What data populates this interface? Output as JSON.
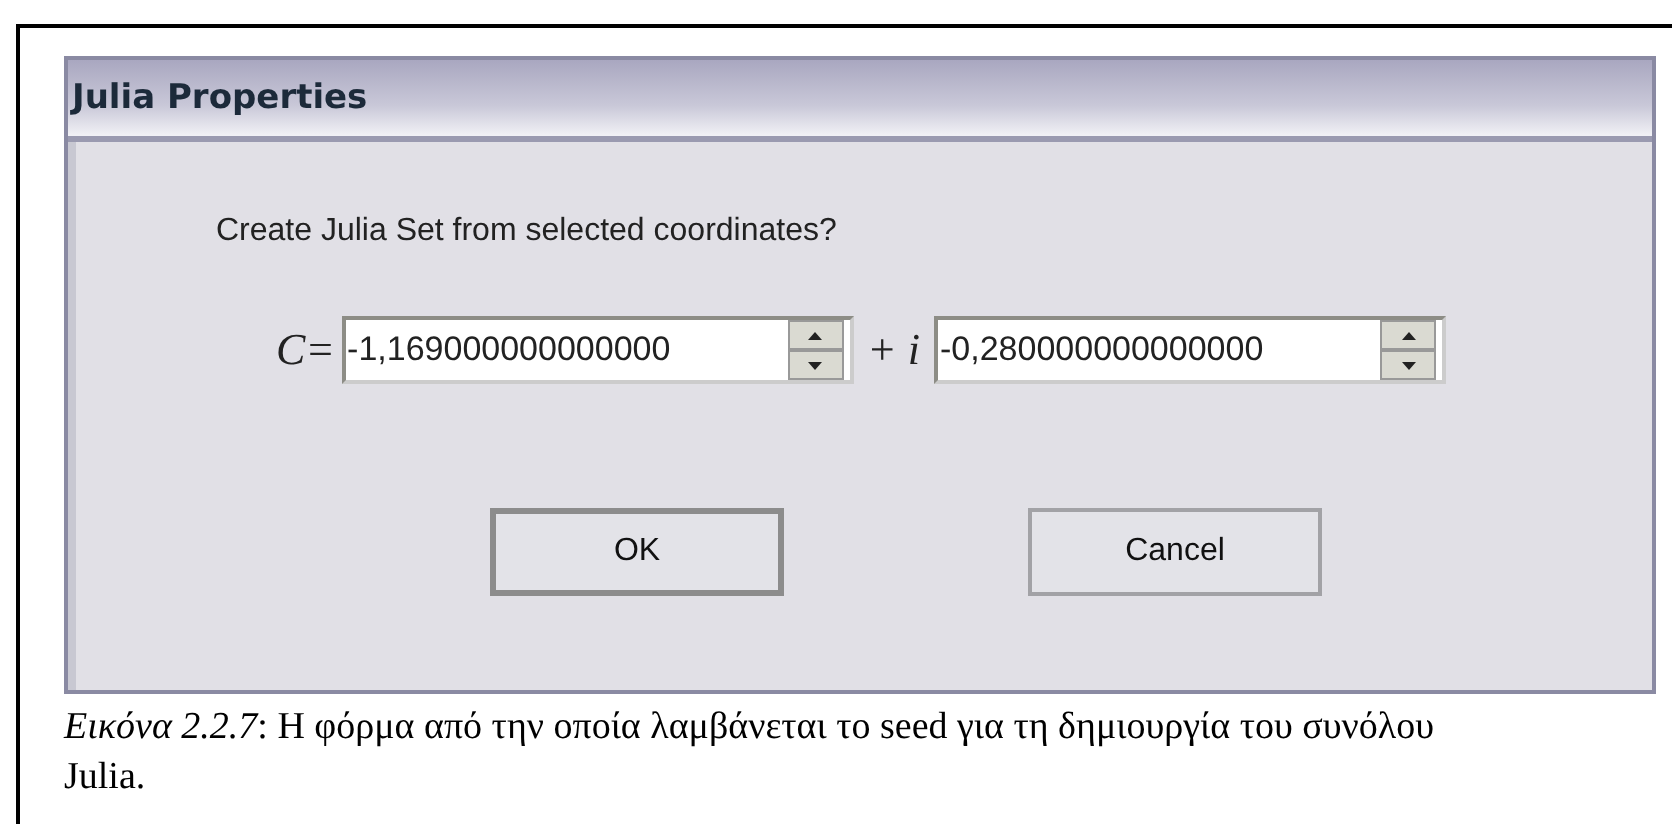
{
  "window": {
    "title": "Julia Properties"
  },
  "prompt": "Create Julia Set from selected coordinates?",
  "equation": {
    "lhs": "C=",
    "real": {
      "value": "-1,169000000000000"
    },
    "operator": "+ i",
    "imaginary": {
      "value": "-0,280000000000000"
    }
  },
  "buttons": [
    {
      "label": "OK",
      "default": true
    },
    {
      "label": "Cancel",
      "default": false
    }
  ],
  "caption": "*Εικόνα 2.2.7*: Η φόρμα από την οποία λαμβάνεται το seed για τη δημιουργία του συνόλου Julia."
}
